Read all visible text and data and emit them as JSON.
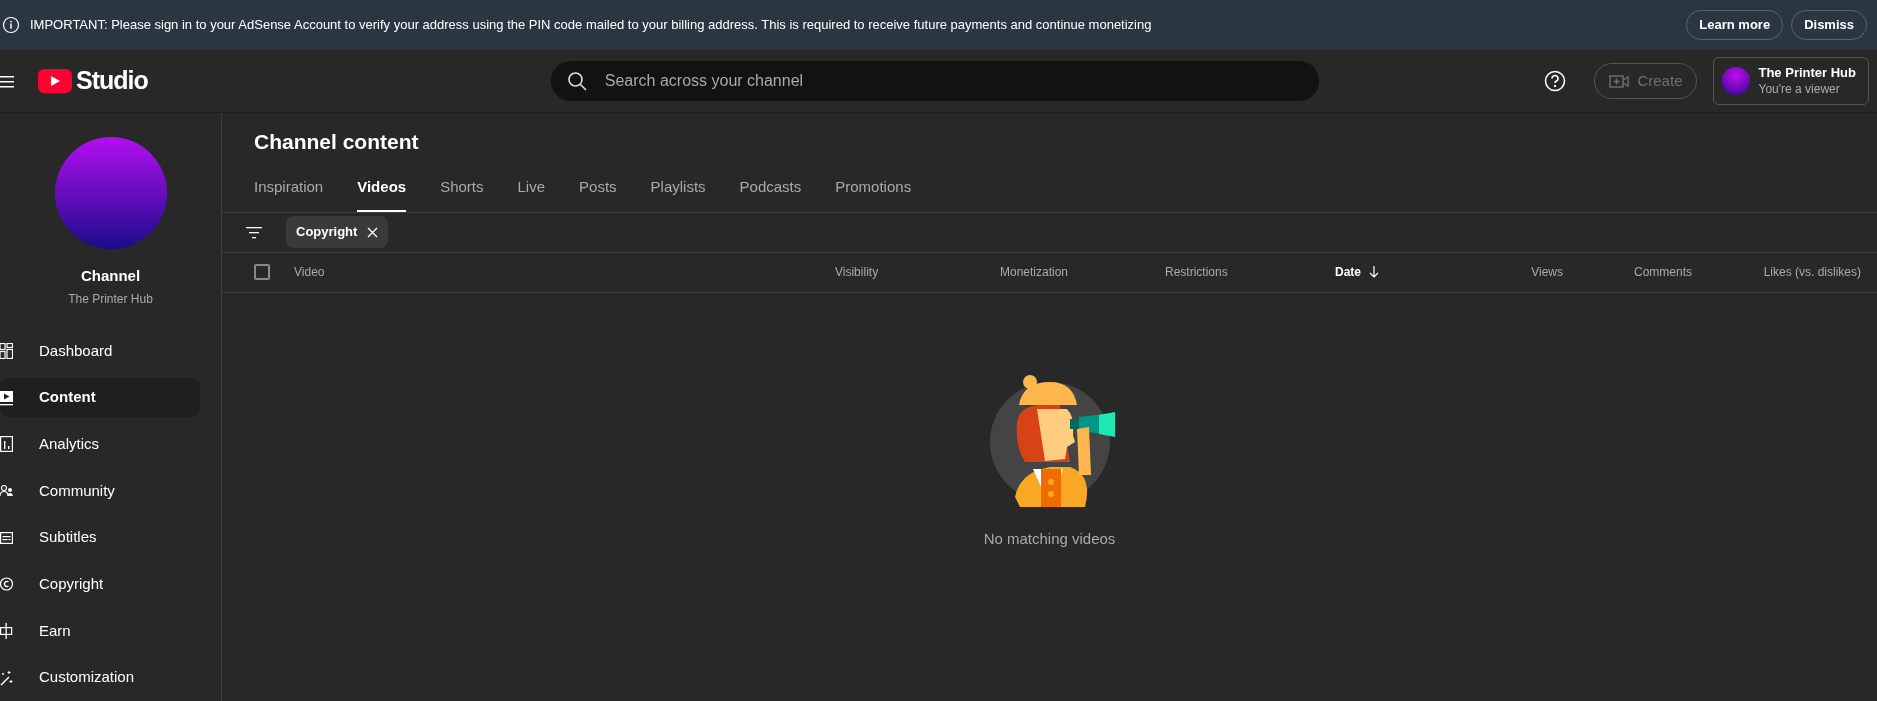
{
  "banner": {
    "message": "IMPORTANT: Please sign in to your AdSense Account to verify your address using the PIN code mailed to your billing address. This is required to receive future payments and continue monetizing",
    "buttons": [
      {
        "label": "Learn more"
      },
      {
        "label": "Dismiss"
      }
    ]
  },
  "header": {
    "logo_text": "Studio",
    "search_placeholder": "Search across your channel",
    "create": {
      "label": "Create",
      "disabled": true
    },
    "account": {
      "name": "The Printer Hub",
      "role": "You're a viewer"
    }
  },
  "sidebar": {
    "channel": {
      "label": "Channel",
      "name": "The Printer Hub"
    },
    "items": [
      {
        "label": "Dashboard",
        "selected": false
      },
      {
        "label": "Content",
        "selected": true
      },
      {
        "label": "Analytics",
        "selected": false
      },
      {
        "label": "Community",
        "selected": false
      },
      {
        "label": "Subtitles",
        "selected": false
      },
      {
        "label": "Copyright",
        "selected": false
      },
      {
        "label": "Earn",
        "selected": false
      },
      {
        "label": "Customization",
        "selected": false
      }
    ]
  },
  "page": {
    "title": "Channel content",
    "tabs": [
      {
        "label": "Inspiration",
        "selected": false
      },
      {
        "label": "Videos",
        "selected": true
      },
      {
        "label": "Shorts",
        "selected": false
      },
      {
        "label": "Live",
        "selected": false
      },
      {
        "label": "Posts",
        "selected": false
      },
      {
        "label": "Playlists",
        "selected": false
      },
      {
        "label": "Podcasts",
        "selected": false
      },
      {
        "label": "Promotions",
        "selected": false
      }
    ],
    "filter_chips": [
      {
        "label": "Copyright"
      }
    ],
    "table": {
      "select_all_checked": false,
      "columns": [
        {
          "label": "Video",
          "sorted": false
        },
        {
          "label": "Visibility",
          "sorted": false
        },
        {
          "label": "Monetization",
          "sorted": false
        },
        {
          "label": "Restrictions",
          "sorted": false
        },
        {
          "label": "Date",
          "sorted": true
        },
        {
          "label": "Views",
          "sorted": false
        },
        {
          "label": "Comments",
          "sorted": false
        },
        {
          "label": "Likes (vs. dislikes)",
          "sorted": false
        }
      ]
    },
    "empty_message": "No matching videos"
  }
}
